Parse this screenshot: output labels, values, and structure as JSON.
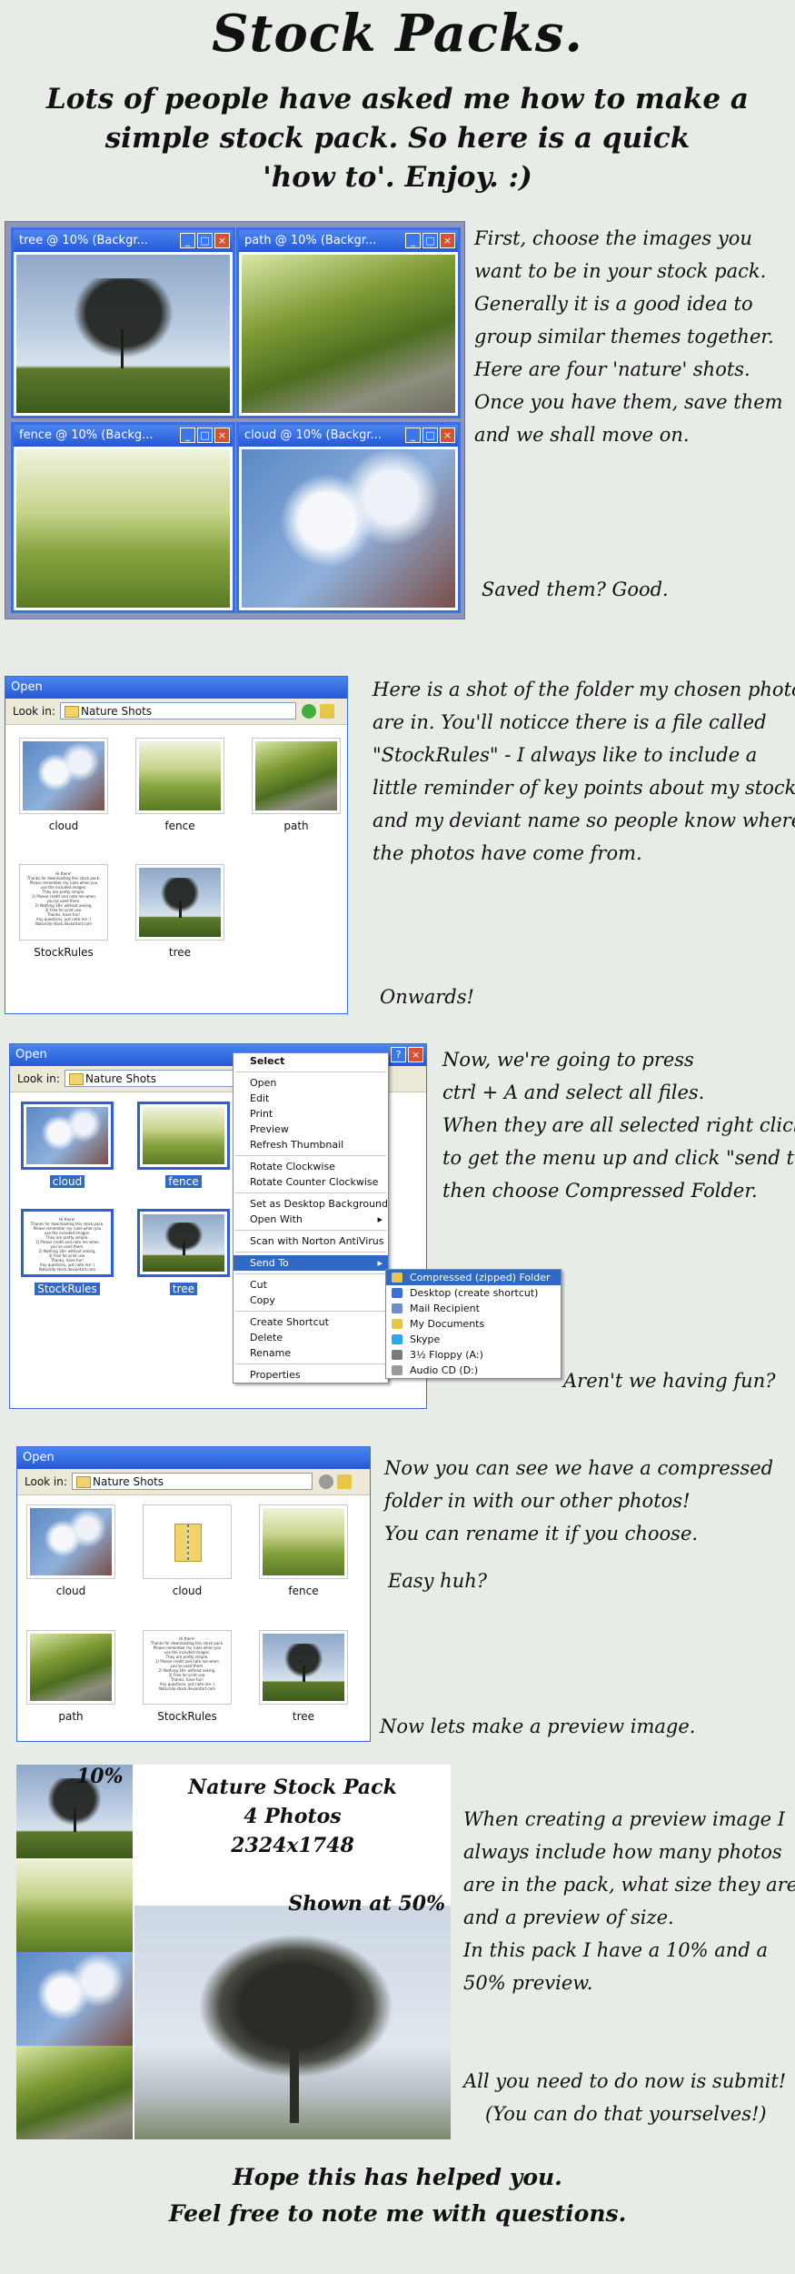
{
  "title": "Stock Packs.",
  "intro": {
    "line1": "Lots of people have asked me how to make a",
    "line2": "simple stock pack. So here is a quick",
    "line3": "'how to'. Enjoy. :)"
  },
  "step1": {
    "windows": [
      {
        "title": "tree @ 10% (Backgr...",
        "photo": "tree"
      },
      {
        "title": "path @ 10% (Backgr...",
        "photo": "path"
      },
      {
        "title": "fence @ 10% (Backg...",
        "photo": "fence"
      },
      {
        "title": "cloud @ 10% (Backgr...",
        "photo": "cloud"
      }
    ],
    "text": [
      "First, choose the images you",
      "want to be in your stock pack.",
      "Generally it is a good idea to",
      "group similar themes together.",
      "Here are four 'nature' shots.",
      "Once you have them, save them",
      "and we shall move on."
    ],
    "aside": "Saved them? Good."
  },
  "step2": {
    "dialog_title": "Open",
    "look_in_label": "Look in:",
    "folder": "Nature Shots",
    "files": [
      {
        "label": "cloud",
        "kind": "cloud"
      },
      {
        "label": "fence",
        "kind": "fence"
      },
      {
        "label": "path",
        "kind": "lane"
      },
      {
        "label": "StockRules",
        "kind": "doc"
      },
      {
        "label": "tree",
        "kind": "sky"
      }
    ],
    "doc_text": "Hi there!\nThanks for downloading this stock pack.\nPlease remember my rules when you use the included images.\nThey are pretty simple.\n1) Please credit and note me when you've used them.\n2) Nothing 18+ without asking.\n3) Free for print use.\nThanks, have fun!\nAny questions, just note me :)\nNaturally-stock.deviantart.com",
    "text": [
      "Here is a shot of the folder my chosen photos",
      "are in. You'll noticce there is a file called",
      "\"StockRules\" - I always like to include a",
      "little reminder of key points about my stock",
      "and my deviant name so people know where",
      "the photos have come from."
    ],
    "aside": "Onwards!"
  },
  "step3": {
    "dialog_title": "Open",
    "look_in_label": "Look in:",
    "folder": "Nature Shots",
    "files": [
      {
        "label": "cloud",
        "kind": "cloud"
      },
      {
        "label": "fence",
        "kind": "fence"
      },
      {
        "label": "StockRules",
        "kind": "doc"
      },
      {
        "label": "tree",
        "kind": "sky"
      }
    ],
    "menu": [
      {
        "label": "Select",
        "bold": true
      },
      {
        "sep": true
      },
      {
        "label": "Open"
      },
      {
        "label": "Edit"
      },
      {
        "label": "Print"
      },
      {
        "label": "Preview"
      },
      {
        "label": "Refresh Thumbnail"
      },
      {
        "sep": true
      },
      {
        "label": "Rotate Clockwise"
      },
      {
        "label": "Rotate Counter Clockwise"
      },
      {
        "sep": true
      },
      {
        "label": "Set as Desktop Background"
      },
      {
        "label": "Open With",
        "arrow": true
      },
      {
        "sep": true
      },
      {
        "label": "Scan with Norton AntiVirus"
      },
      {
        "sep": true
      },
      {
        "label": "Send To",
        "arrow": true,
        "highlight": true
      },
      {
        "sep": true
      },
      {
        "label": "Cut"
      },
      {
        "label": "Copy"
      },
      {
        "sep": true
      },
      {
        "label": "Create Shortcut"
      },
      {
        "label": "Delete"
      },
      {
        "label": "Rename"
      },
      {
        "sep": true
      },
      {
        "label": "Properties"
      }
    ],
    "submenu": [
      {
        "label": "Compressed (zipped) Folder",
        "highlight": true,
        "color": "#e8c547"
      },
      {
        "label": "Desktop (create shortcut)",
        "color": "#3a6fd8"
      },
      {
        "label": "Mail Recipient",
        "color": "#6d8cc9"
      },
      {
        "label": "My Documents",
        "color": "#e8c547"
      },
      {
        "label": "Skype",
        "color": "#2aa9e8"
      },
      {
        "label": "3½ Floppy (A:)",
        "color": "#7a7a7a"
      },
      {
        "label": "Audio CD (D:)",
        "color": "#9a9a9a"
      }
    ],
    "text": [
      "Now, we're going to press",
      "ctrl + A and select all files.",
      "When they are all selected right click",
      "to get the menu up and click \"send to\"",
      "then choose Compressed Folder."
    ],
    "aside": "Aren't we having fun?"
  },
  "step4": {
    "dialog_title": "Open",
    "look_in_label": "Look in:",
    "folder": "Nature Shots",
    "files": [
      {
        "label": "cloud",
        "kind": "cloud"
      },
      {
        "label": "cloud",
        "kind": "zip"
      },
      {
        "label": "fence",
        "kind": "fence"
      },
      {
        "label": "path",
        "kind": "lane"
      },
      {
        "label": "StockRules",
        "kind": "doc"
      },
      {
        "label": "tree",
        "kind": "sky"
      }
    ],
    "text": [
      "Now you can see we have a compressed",
      "folder in with our other photos!",
      "You can rename it if you choose."
    ],
    "easy": "Easy huh?",
    "aside": "Now lets make a preview image."
  },
  "step5": {
    "label_10": "10%",
    "pack_title": "Nature Stock Pack",
    "pack_count": "4 Photos",
    "pack_size": "2324x1748",
    "shown_at": "Shown at 50%",
    "text": [
      "When creating a preview image I",
      "always include how many photos",
      "are in the pack, what size they are",
      "and a preview of size.",
      "In this pack I have a 10% and a",
      "50% preview."
    ],
    "submit1": "All you need to do now is submit!",
    "submit2": "(You can do that yourselves!)"
  },
  "footer": {
    "line1": "Hope this has helped you.",
    "line2": "Feel free to note me with questions."
  }
}
